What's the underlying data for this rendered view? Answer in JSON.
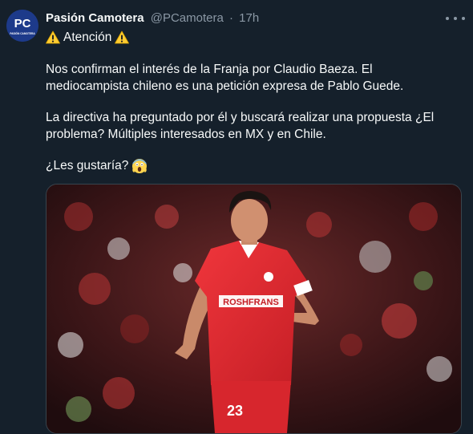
{
  "author": {
    "name": "Pasión Camotera",
    "handle": "@PCamotera",
    "separator": "·",
    "time": "17h",
    "avatar_text_top": "PC",
    "avatar_text_bottom": "PASIÓN CAMOTERA"
  },
  "tweet": {
    "line1": "Atención",
    "paragraph1": "Nos confirman el interés de la Franja por Claudio Baeza. El mediocampista chileno es una petición expresa de Pablo Guede.",
    "paragraph2": "La directiva ha preguntado por él y buscará realizar una propuesta ¿El problema? Múltiples interesados en MX y en Chile.",
    "paragraph3": "¿Les gustaría?"
  },
  "media": {
    "jersey_sponsor": "ROSHFRANS",
    "jersey_number": "23"
  },
  "icons": {
    "warning": "warning-icon",
    "scream": "face-screaming-icon",
    "more": "more-options-icon"
  },
  "colors": {
    "background": "#15202b",
    "text": "#f7f9f9",
    "secondary": "#8b98a5",
    "jersey_red": "#e0292f"
  }
}
